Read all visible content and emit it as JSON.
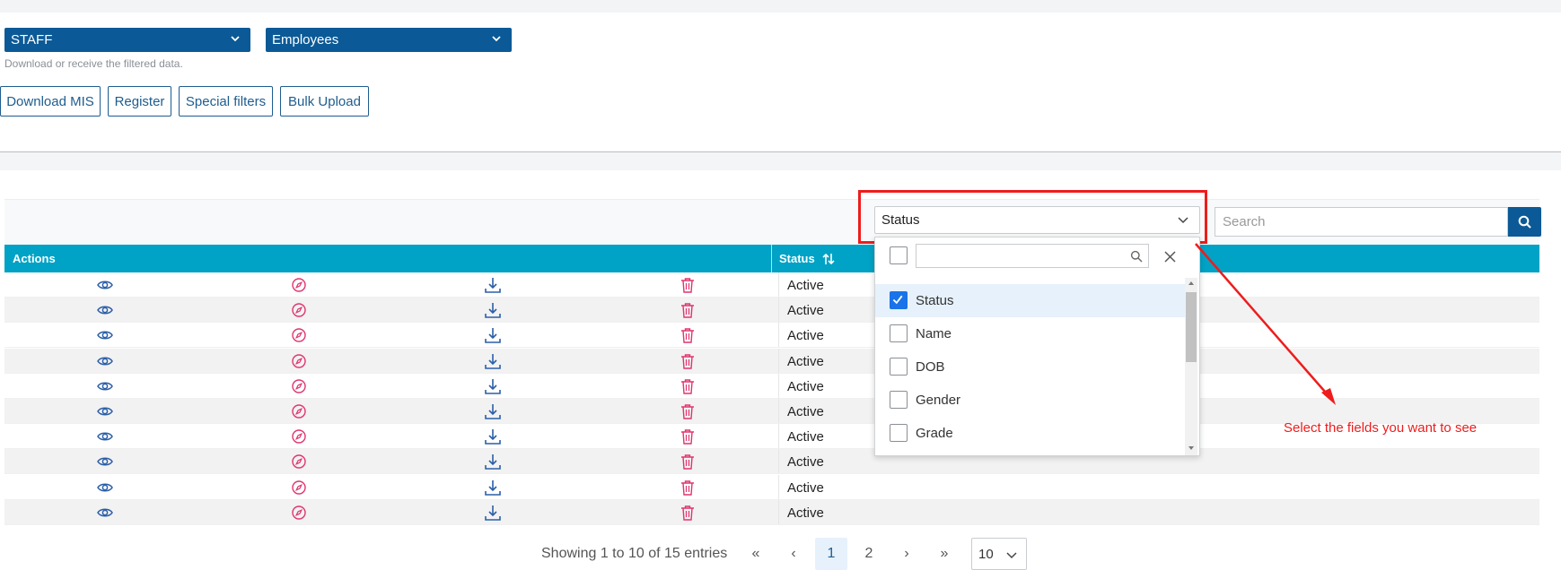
{
  "filters": {
    "category": "STAFF",
    "subcategory": "Employees",
    "hint": "Download or receive the filtered data."
  },
  "buttons": {
    "download_mis": "Download MIS",
    "register": "Register",
    "special_filters": "Special filters",
    "bulk_upload": "Bulk Upload"
  },
  "toolbar": {
    "column_select_value": "Status",
    "search_placeholder": "Search"
  },
  "table": {
    "headers": {
      "actions": "Actions",
      "status": "Status"
    },
    "rows": [
      {
        "status": "Active"
      },
      {
        "status": "Active"
      },
      {
        "status": "Active"
      },
      {
        "status": "Active"
      },
      {
        "status": "Active"
      },
      {
        "status": "Active"
      },
      {
        "status": "Active"
      },
      {
        "status": "Active"
      },
      {
        "status": "Active"
      },
      {
        "status": "Active"
      }
    ],
    "row_action_icons": [
      "eye-icon",
      "compass-icon",
      "download-icon",
      "trash-icon"
    ]
  },
  "column_dropdown": {
    "options": [
      {
        "label": "Status",
        "checked": true
      },
      {
        "label": "Name",
        "checked": false
      },
      {
        "label": "DOB",
        "checked": false
      },
      {
        "label": "Gender",
        "checked": false
      },
      {
        "label": "Grade",
        "checked": false
      }
    ]
  },
  "annotation": "Select the fields you want to see",
  "pagination": {
    "info": "Showing 1 to 10 of 15 entries",
    "first": "«",
    "prev": "‹",
    "pages": [
      "1",
      "2"
    ],
    "current_page": "1",
    "next": "›",
    "last": "»",
    "page_size": "10"
  },
  "colors": {
    "primary": "#0b5a97",
    "table_header": "#00a2c5",
    "annotation_red": "#ee1c1c",
    "icon_blue": "#2b5fa8",
    "icon_pink": "#e0346e"
  }
}
